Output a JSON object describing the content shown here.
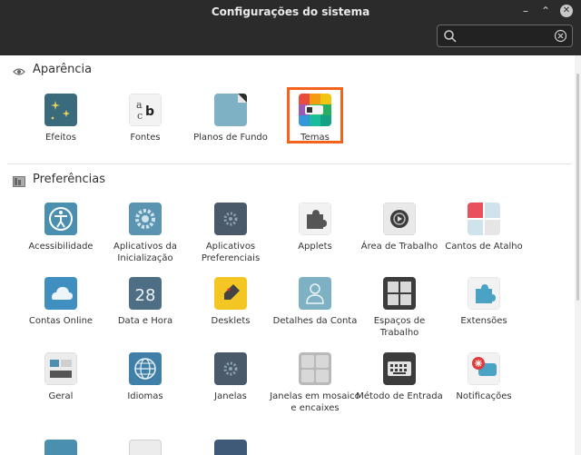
{
  "window": {
    "title": "Configurações do sistema",
    "minimize_glyph": "–",
    "maximize_glyph": "⌃",
    "close_glyph": "✕"
  },
  "search": {
    "value": "",
    "placeholder": "",
    "search_icon": "search-icon",
    "clear_icon": "clear-icon"
  },
  "sections": [
    {
      "title": "Aparência",
      "icon": "eye-icon",
      "items": [
        {
          "label": "Efeitos",
          "icon": "effects-icon"
        },
        {
          "label": "Fontes",
          "icon": "fonts-icon"
        },
        {
          "label": "Planos de Fundo",
          "icon": "backgrounds-icon"
        },
        {
          "label": "Temas",
          "icon": "themes-icon",
          "selected": true
        }
      ]
    },
    {
      "title": "Preferências",
      "icon": "preferences-icon",
      "items": [
        {
          "label": "Acessibilidade",
          "icon": "accessibility-icon"
        },
        {
          "label": "Aplicativos da Inicialização",
          "icon": "startup-apps-icon"
        },
        {
          "label": "Aplicativos Preferenciais",
          "icon": "preferred-apps-icon"
        },
        {
          "label": "Applets",
          "icon": "applets-icon"
        },
        {
          "label": "Área de Trabalho",
          "icon": "desktop-icon"
        },
        {
          "label": "Cantos de Atalho",
          "icon": "hot-corners-icon"
        },
        {
          "label": "Contas Online",
          "icon": "online-accounts-icon"
        },
        {
          "label": "Data e Hora",
          "icon": "date-time-icon",
          "day": "28"
        },
        {
          "label": "Desklets",
          "icon": "desklets-icon"
        },
        {
          "label": "Detalhes da Conta",
          "icon": "account-details-icon"
        },
        {
          "label": "Espaços de Trabalho",
          "icon": "workspaces-icon"
        },
        {
          "label": "Extensões",
          "icon": "extensions-icon"
        },
        {
          "label": "Geral",
          "icon": "general-icon"
        },
        {
          "label": "Idiomas",
          "icon": "languages-icon"
        },
        {
          "label": "Janelas",
          "icon": "windows-icon"
        },
        {
          "label": "Janelas em mosaico e encaixes",
          "icon": "window-tiling-icon"
        },
        {
          "label": "Método de Entrada",
          "icon": "input-method-icon"
        },
        {
          "label": "Notificações",
          "icon": "notifications-icon"
        }
      ]
    }
  ],
  "colors": {
    "accent_selected": "#f4631e",
    "titlebar": "#2b2b2b",
    "background": "#ffffff"
  }
}
